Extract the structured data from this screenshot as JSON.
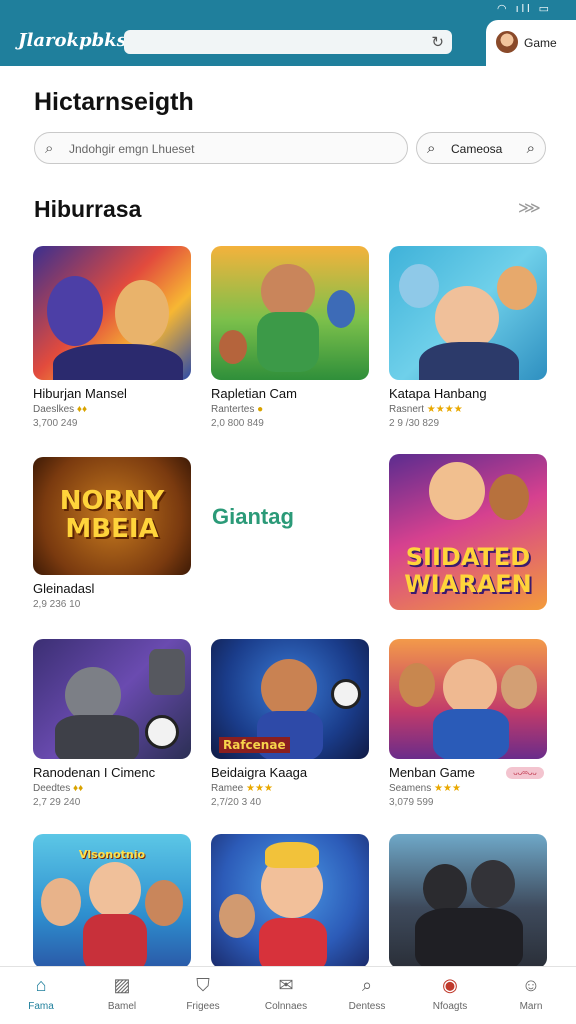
{
  "status": {
    "icons": "◠ ıll ▭"
  },
  "header": {
    "brand": "Jlarokpbks",
    "search_placeholder": "",
    "refresh_icon": "refresh-icon",
    "game_label": "Game"
  },
  "page": {
    "title": "Hictarnseigth",
    "search_placeholder": "Jndohgir emgn Lhueset",
    "games_button": "Cameosa"
  },
  "section": {
    "title": "Hiburrasa",
    "more": "⋙"
  },
  "cards": [
    {
      "title": "Hiburjan Mansel",
      "meta": "Daeslkes",
      "rating": "♦♦",
      "count": "3,700 249"
    },
    {
      "title": "Rapletian Cam",
      "meta": "Rantertes",
      "rating": "●",
      "count": "2,0 800 849"
    },
    {
      "title": "Katapa Hanbang",
      "meta": "Rasnert",
      "rating": "★★★★",
      "count": "2 9 /30 829"
    },
    {
      "title": "Gleinadasl",
      "meta": "",
      "rating": "",
      "count": "2,9 236 10",
      "art": "NORNY MBEIA"
    },
    {
      "text_tile": "Giantag"
    },
    {
      "title": "",
      "meta": "",
      "rating": "",
      "count": "",
      "art": "SIIDATED WIARAEN"
    },
    {
      "title": "Ranodenan I Cimenc",
      "meta": "Deedtes",
      "rating": "♦♦",
      "count": "2,7 29 240"
    },
    {
      "title": "Beidaigra Kaaga",
      "meta": "Ramee",
      "rating": "★★★",
      "count": "2,7/20 3 40",
      "art": "Rafcenae"
    },
    {
      "title": "Menban Game",
      "meta": "Seamens",
      "rating": "★★★",
      "count": "3,079 599",
      "badge": "ᴗᴗ∞ᴗᴗ"
    },
    {
      "title": "",
      "meta": "",
      "rating": "",
      "count": "",
      "art": "Vlsonotnio"
    },
    {
      "title": "",
      "meta": "",
      "rating": "",
      "count": ""
    },
    {
      "title": "",
      "meta": "",
      "rating": "",
      "count": ""
    }
  ],
  "nav": [
    {
      "label": "Fama",
      "icon": "home-icon"
    },
    {
      "label": "Bamel",
      "icon": "gallery-icon"
    },
    {
      "label": "Frigees",
      "icon": "shield-icon"
    },
    {
      "label": "Colnnaes",
      "icon": "mail-icon"
    },
    {
      "label": "Dentess",
      "icon": "search-icon"
    },
    {
      "label": "Nfoagts",
      "icon": "record-icon"
    },
    {
      "label": "Marn",
      "icon": "profile-icon"
    }
  ],
  "colors": {
    "accent": "#1f7f9c",
    "text_tile": "#2b9a78"
  }
}
